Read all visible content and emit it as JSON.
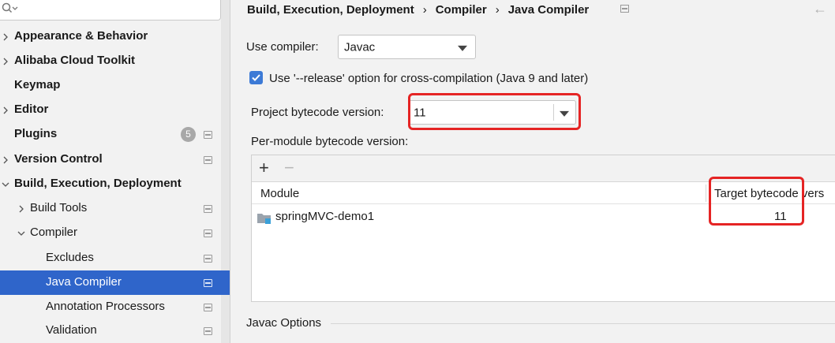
{
  "sidebar": {
    "search_placeholder": "",
    "items": [
      {
        "label": "Appearance & Behavior",
        "bold": true,
        "chevron": "right"
      },
      {
        "label": "Alibaba Cloud Toolkit",
        "bold": true,
        "chevron": "right"
      },
      {
        "label": "Keymap",
        "bold": true,
        "chevron": "none"
      },
      {
        "label": "Editor",
        "bold": true,
        "chevron": "right"
      },
      {
        "label": "Plugins",
        "bold": true,
        "chevron": "none",
        "badge": "5"
      },
      {
        "label": "Version Control",
        "bold": true,
        "chevron": "right"
      },
      {
        "label": "Build, Execution, Deployment",
        "bold": true,
        "chevron": "down"
      },
      {
        "label": "Build Tools",
        "bold": false,
        "chevron": "right"
      },
      {
        "label": "Compiler",
        "bold": false,
        "chevron": "down"
      },
      {
        "label": "Excludes",
        "bold": false,
        "chevron": "none"
      },
      {
        "label": "Java Compiler",
        "bold": false,
        "chevron": "none",
        "selected": true
      },
      {
        "label": "Annotation Processors",
        "bold": false,
        "chevron": "none"
      },
      {
        "label": "Validation",
        "bold": false,
        "chevron": "none"
      }
    ]
  },
  "breadcrumb": [
    "Build, Execution, Deployment",
    "Compiler",
    "Java Compiler"
  ],
  "breadcrumb_sep": "›",
  "back_icon": "←",
  "use_compiler": {
    "label": "Use compiler:",
    "value": "Javac"
  },
  "release_option": {
    "label": "Use '--release' option for cross-compilation (Java 9 and later)",
    "checked": true
  },
  "project_bytecode": {
    "label": "Project bytecode version:",
    "value": "11"
  },
  "per_module": {
    "label": "Per-module bytecode version:",
    "add": "+",
    "remove": "−",
    "columns": [
      "Module",
      "Target bytecode vers"
    ],
    "rows": [
      {
        "module": "springMVC-demo1",
        "target": "11"
      }
    ]
  },
  "javac_options": "Javac Options",
  "colors": {
    "accent": "#2f65ca",
    "highlight": "#e52424",
    "checkbox": "#3c7ad6"
  }
}
